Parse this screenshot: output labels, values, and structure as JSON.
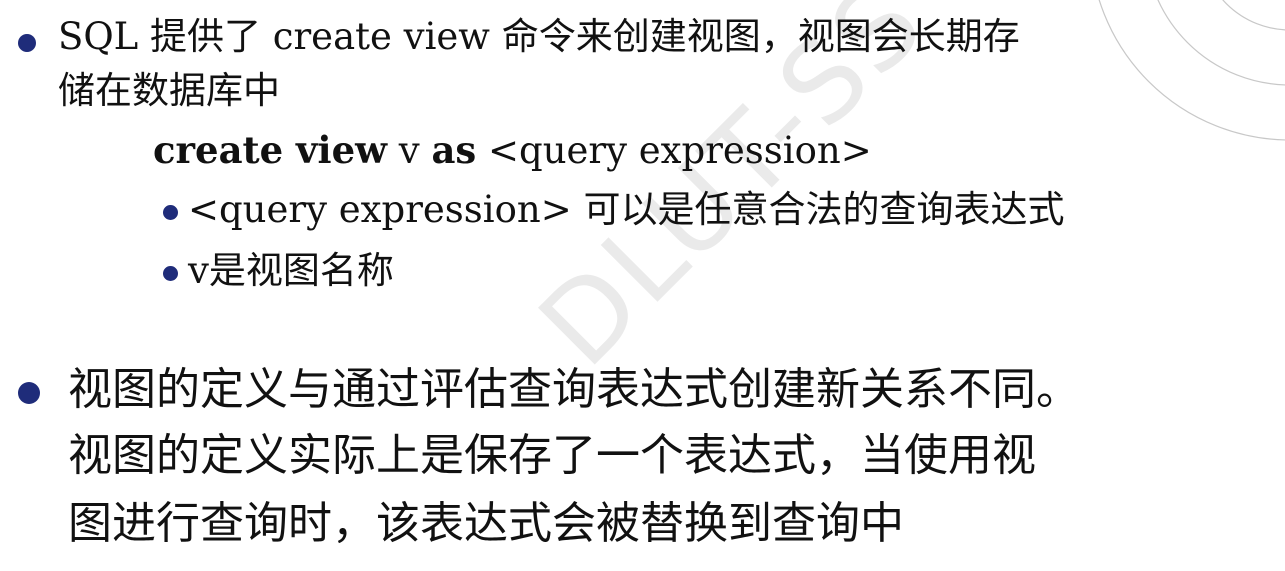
{
  "watermark": "DLUT-SS",
  "bullet1": {
    "line1": "SQL 提供了 create view 命令来创建视图，视图会长期存",
    "line2": "储在数据库中"
  },
  "code": {
    "kw1": "create view",
    "name": "v",
    "kw2": "as",
    "expr": "<query expression>"
  },
  "subbullets": [
    "<query expression> 可以是任意合法的查询表达式",
    "v是视图名称"
  ],
  "bullet2": {
    "line1": "视图的定义与通过评估查询表达式创建新关系不同。",
    "line2": "视图的定义实际上是保存了一个表达式，当使用视",
    "line3": "图进行查询时，该表达式会被替换到查询中"
  },
  "colors": {
    "bullet": "#1f2c7a",
    "text": "#111111",
    "arcs": "#c8c8c8",
    "watermark": "#a0a0a0"
  }
}
